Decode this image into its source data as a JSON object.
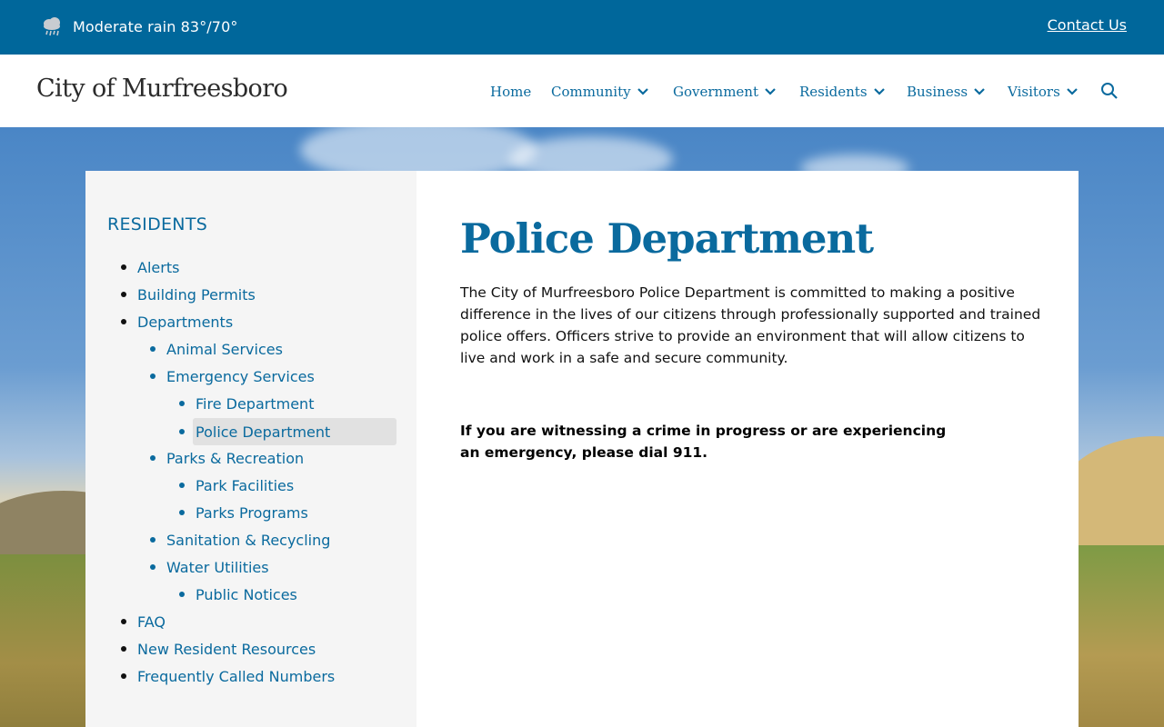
{
  "topbar": {
    "weather_icon": "rain-cloud-icon",
    "weather_text": "Moderate rain 83°/70°",
    "contact_label": "Contact Us"
  },
  "header": {
    "site_title": "City of Murfreesboro",
    "nav": [
      {
        "label": "Home"
      },
      {
        "label": "Community",
        "icon": "chevron-down-icon"
      },
      {
        "label": "Government",
        "icon": "chevron-down-icon"
      },
      {
        "label": "Residents",
        "icon": "chevron-down-icon"
      },
      {
        "label": "Business",
        "icon": "chevron-down-icon"
      },
      {
        "label": "Visitors",
        "icon": "chevron-down-icon"
      }
    ],
    "search_icon": "search-icon"
  },
  "sidebar": {
    "heading": "RESIDENTS",
    "items": [
      {
        "label": "Alerts",
        "level": 0
      },
      {
        "label": "Building Permits",
        "level": 0
      },
      {
        "label": "Departments",
        "level": 0
      },
      {
        "label": "Animal Services",
        "level": 1
      },
      {
        "label": "Emergency Services",
        "level": 1
      },
      {
        "label": "Fire Department",
        "level": 2
      },
      {
        "label": "Police Department",
        "level": 2,
        "active": true
      },
      {
        "label": "Parks & Recreation",
        "level": 1
      },
      {
        "label": "Park Facilities",
        "level": 2
      },
      {
        "label": "Parks Programs",
        "level": 2
      },
      {
        "label": "Sanitation & Recycling",
        "level": 1
      },
      {
        "label": "Water Utilities",
        "level": 1
      },
      {
        "label": "Public Notices",
        "level": 2
      },
      {
        "label": "FAQ",
        "level": 0
      },
      {
        "label": "New Resident Resources",
        "level": 0
      },
      {
        "label": "Frequently Called Numbers",
        "level": 0
      }
    ]
  },
  "main": {
    "title": "Police Department",
    "intro": "The City of Murfreesboro Police Department is committed to making a positive difference in the lives of our citizens through professionally supported and trained police offers. Officers strive to provide an environment that will allow citizens to live and work in a safe and secure community.",
    "emergency": "If you are witnessing a crime in progress or are experiencing an emergency, please dial 911."
  },
  "colors": {
    "topbar": "#00679b",
    "link": "#0a6a9e",
    "sidebar_bg": "#f5f5f5",
    "active_bg": "#e1e1e1"
  }
}
